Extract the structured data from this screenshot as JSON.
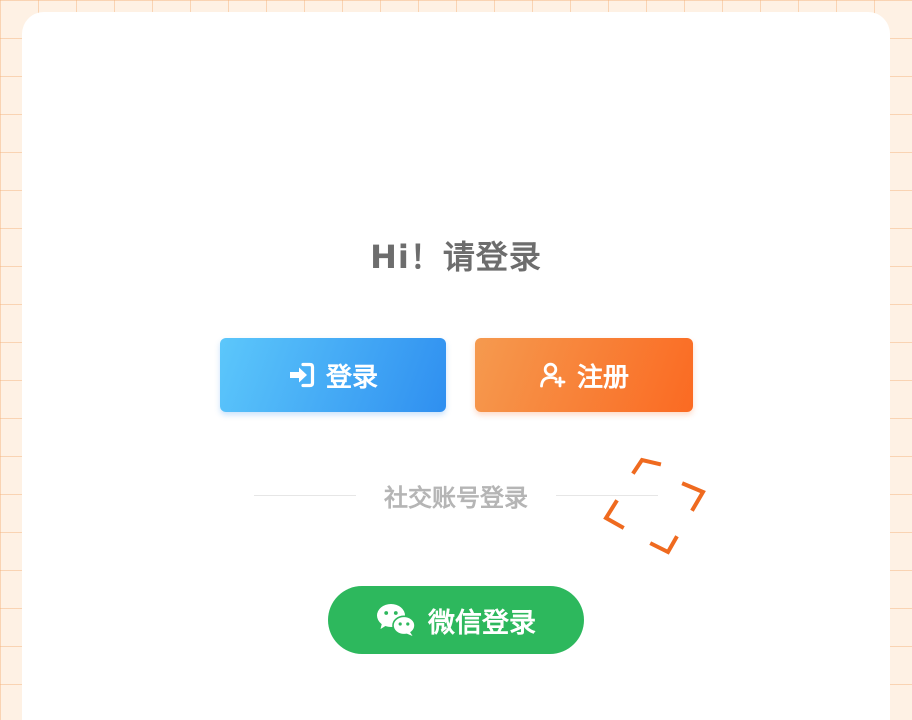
{
  "page": {
    "title": "Hi！请登录"
  },
  "actions": {
    "login_label": "登录",
    "register_label": "注册"
  },
  "social": {
    "divider_label": "社交账号登录",
    "wechat_label": "微信登录"
  },
  "icons": {
    "login": "sign-in-icon",
    "register": "user-add-icon",
    "wechat": "wechat-icon",
    "scan": "scan-frame-icon"
  },
  "colors": {
    "login_gradient_start": "#5cc7fb",
    "login_gradient_end": "#2f8ff0",
    "register_gradient_start": "#f59a4f",
    "register_gradient_end": "#fb6a22",
    "wechat": "#2db85d",
    "background": "#fef1e4",
    "title_text": "#6d6d6d"
  }
}
